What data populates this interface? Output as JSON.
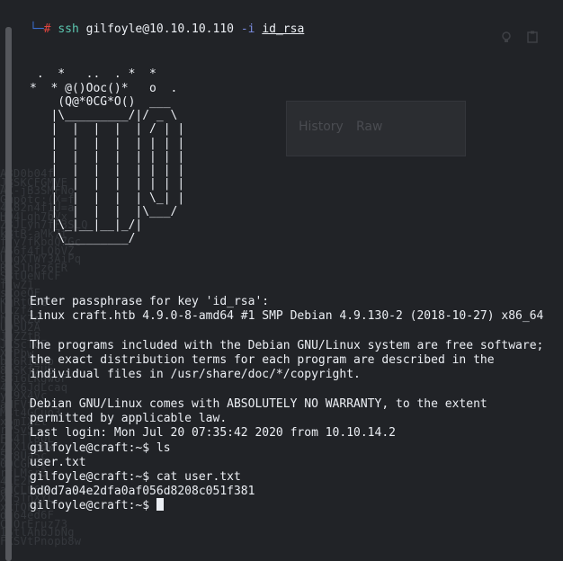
{
  "background": {
    "tabs": [
      "History",
      "Raw"
    ],
    "hash_fragments": [
      "A8D0b04f",
      "JBSKCFGMVE",
      "AX-jB3SMFNo",
      "Gmpotc:(X=f",
      "4A82n4f1U=a",
      "HQ4Lgh7bVx",
      "Z8JLyh7fF3SLQ",
      "kBtR-aMk7t",
      "fYy7fKbdQ7Gc",
      "AS6f4fLQbVZ",
      "UhgXTWY3AiPq",
      "RgS1hPz6FR",
      "SBtUeNfCF",
      "fJwZ1",
      "sXoeQF",
      "KuRtQ3E",
      "UKzf4",
      "hjRKZa",
      "UD5U2A",
      "JuZZtB",
      "JKScTcE",
      "XrPbw",
      "bc6RIbhb",
      "8aSKf7Ub",
      "s3i6LKgwUF",
      "4aX6JdLcaq",
      "ys9X4Vc",
      "aHFVt",
      "Mst4GCuo3",
      "x6mIXZt",
      "rPSvS",
      "FS4Tl8QL",
      "ZsX1Gbdw",
      "5r8Ua5c",
      "0QCGHcz",
      "rtLMsr3",
      "4LE2k",
      "aHCLL6A",
      "Xr5TnXYL",
      "xkfOFm",
      "dg64ed6F",
      "CdOrEruz73",
      "1StlAhbJbNg",
      "FKSVtPnopb8w"
    ],
    "icons": [
      "lightbulb-icon",
      "clipboard-icon"
    ]
  },
  "terminal": {
    "prompt_corner": "└─",
    "prompt_hash": "#",
    "command": {
      "name": "ssh",
      "target": "gilfoyle@10.10.10.110",
      "flag": "-i",
      "keyfile": "id_rsa"
    },
    "banner": [
      "",
      " .  *   ..  . *  *",
      "*  * @()Ooc()*   o  .",
      "    (Q@*0CG*O()  ___",
      "   |\\_________/|/ _ \\",
      "   |  |  |  |  | / | |",
      "   |  |  |  |  | | | |",
      "   |  |  |  |  | | | |",
      "   |  |  |  |  | | | |",
      "   |  |  |  |  | | | |",
      "   |  |  |  |  | \\_| |",
      "   |  |  |  |  |\\___/",
      "   |\\_|__|__|_/|",
      "    \\_________/"
    ],
    "output": [
      "Enter passphrase for key 'id_rsa':",
      "Linux craft.htb 4.9.0-8-amd64 #1 SMP Debian 4.9.130-2 (2018-10-27) x86_64",
      "",
      "The programs included with the Debian GNU/Linux system are free software;",
      "the exact distribution terms for each program are described in the",
      "individual files in /usr/share/doc/*/copyright.",
      "",
      "Debian GNU/Linux comes with ABSOLUTELY NO WARRANTY, to the extent",
      "permitted by applicable law.",
      "Last login: Mon Jul 20 07:35:42 2020 from 10.10.14.2",
      "gilfoyle@craft:~$ ls",
      "user.txt",
      "gilfoyle@craft:~$ cat user.txt",
      "bd0d7a04e2dfa0af056d8208c051f381"
    ],
    "final_prompt": "gilfoyle@craft:~$ "
  }
}
